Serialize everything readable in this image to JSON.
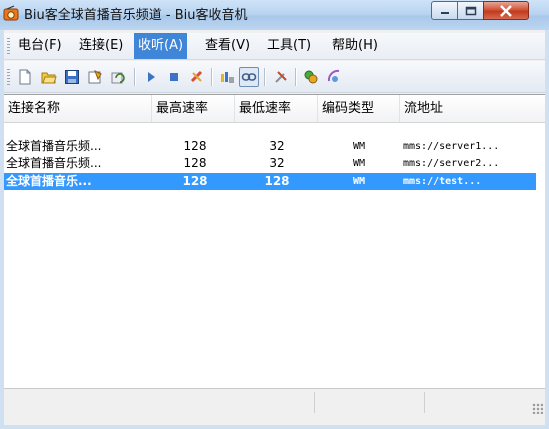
{
  "window": {
    "title": "Biu客全球首播音乐频道 - Biu客收音机"
  },
  "menu": {
    "items": [
      {
        "label": "电台(F)"
      },
      {
        "label": "连接(E)"
      },
      {
        "label": "收听(A)",
        "active": true
      },
      {
        "label": "查看(V)"
      },
      {
        "label": "工具(T)"
      },
      {
        "label": "帮助(H)"
      }
    ]
  },
  "toolbar": {
    "buttons": [
      "new-icon",
      "open-folder-icon",
      "save-icon",
      "properties-icon",
      "refresh-icon",
      "play-icon",
      "stop-icon",
      "disconnect-icon",
      "equalizer-icon",
      "link-icon",
      "tools-icon",
      "plugin-icon",
      "network-icon"
    ]
  },
  "list": {
    "columns": [
      "连接名称",
      "最高速率",
      "最低速率",
      "编码类型",
      "流地址"
    ],
    "rows": [
      {
        "name": "全球首播音乐频...",
        "max": "128",
        "min": "32",
        "codec": "WM",
        "url": "mms://server1..."
      },
      {
        "name": "全球首播音乐频...",
        "max": "128",
        "min": "32",
        "codec": "WM",
        "url": "mms://server2..."
      },
      {
        "name": "全球首播音乐...",
        "max": "128",
        "min": "128",
        "codec": "WM",
        "url": "mms://test...",
        "selected": true
      }
    ]
  },
  "colors": {
    "selection": "#3399ff",
    "menu_active": "#3f86d9",
    "close_button": "#c8432a"
  }
}
